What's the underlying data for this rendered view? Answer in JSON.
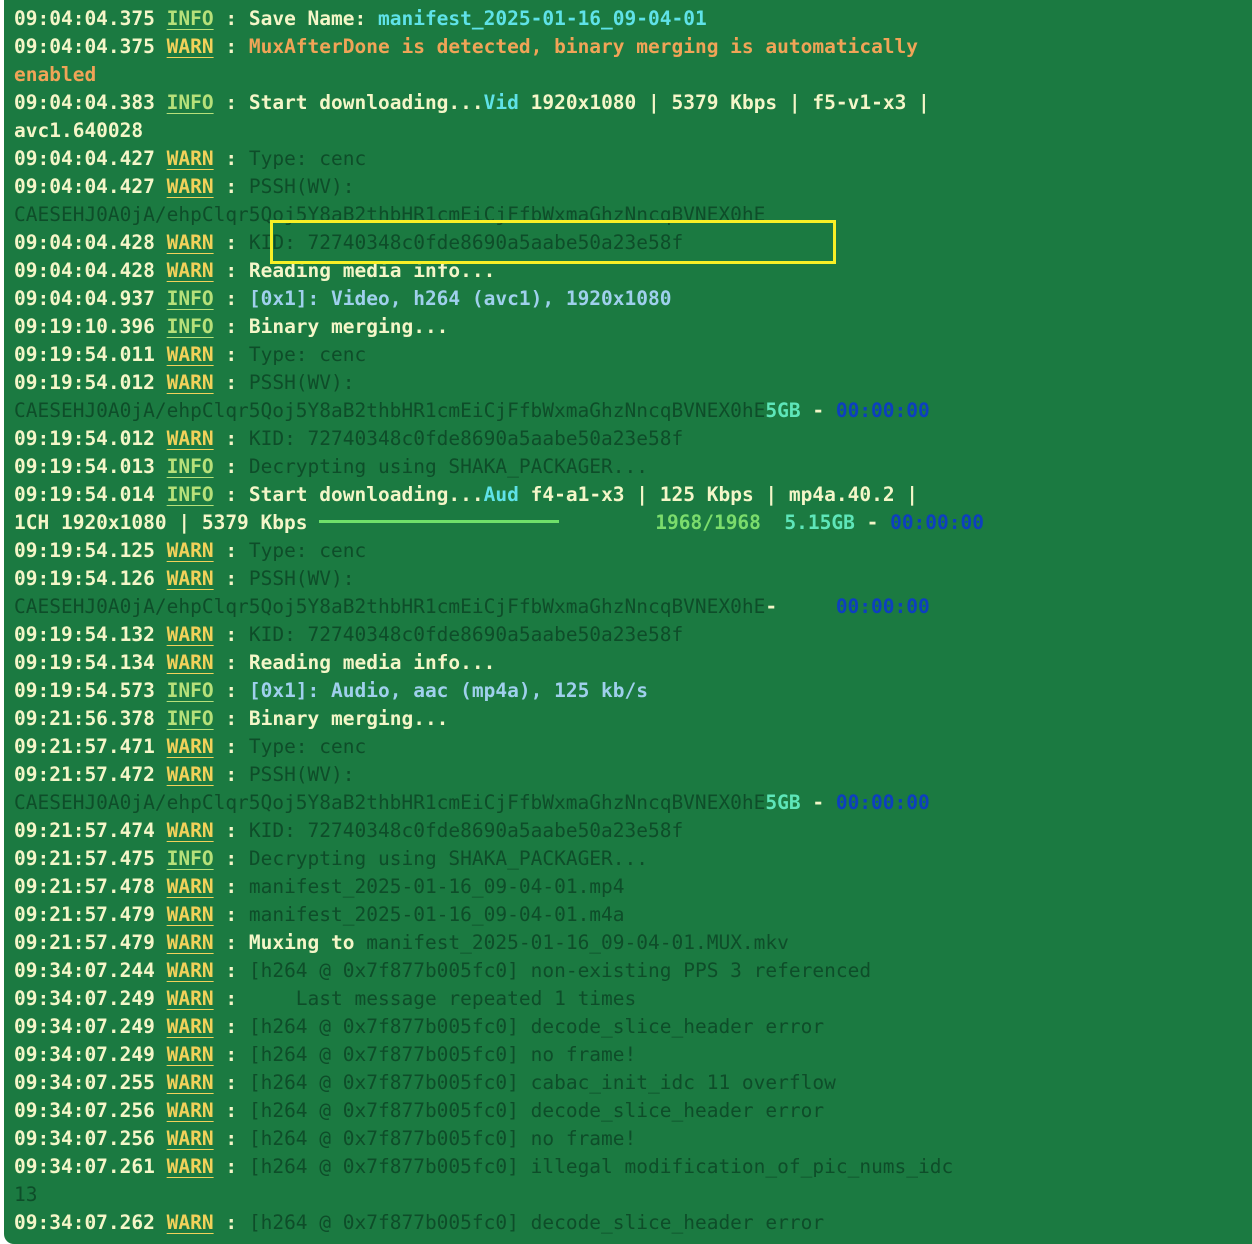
{
  "colors": {
    "background": "#1b7a41",
    "highlight": "#f7f026"
  },
  "lines": [
    {
      "ts": "09:04:04.375",
      "lvl": "INFO",
      "msg": [
        {
          "t": "Save Name: ",
          "c": "norm"
        },
        {
          "t": "manifest_2025-01-16_09-04-01",
          "c": "cyan"
        }
      ]
    },
    {
      "ts": "09:04:04.375",
      "lvl": "WARN",
      "msg": [
        {
          "t": "MuxAfterDone is detected, binary merging is automatically",
          "c": "orange"
        }
      ]
    },
    {
      "raw": [
        {
          "t": "enabled",
          "c": "orange"
        }
      ]
    },
    {
      "ts": "09:04:04.383",
      "lvl": "INFO",
      "msg": [
        {
          "t": "Start downloading...",
          "c": "norm"
        },
        {
          "t": "Vid",
          "c": "cyan"
        },
        {
          "t": " 1920x1080 | 5379 Kbps | f5-v1-x3 |",
          "c": "norm"
        }
      ]
    },
    {
      "raw": [
        {
          "t": "avc1.640028",
          "c": "norm"
        }
      ]
    },
    {
      "ts": "09:04:04.427",
      "lvl": "WARN",
      "msg": [
        {
          "t": "Type: cenc",
          "c": "dim"
        }
      ]
    },
    {
      "ts": "09:04:04.427",
      "lvl": "WARN",
      "msg": [
        {
          "t": "PSSH(WV):",
          "c": "dim"
        }
      ]
    },
    {
      "raw": [
        {
          "t": "CAESEHJ0A0jA/ehpClqr5Qoj5Y8aB2thbHR1cmEiCjFfbWxmaGhzNncqBVNEX0hE",
          "c": "dim"
        }
      ]
    },
    {
      "ts": "09:04:04.428",
      "lvl": "WARN",
      "msg": [
        {
          "t": "KID: 72740348c0fde8690a5aabe50a23e58f",
          "c": "dim"
        }
      ]
    },
    {
      "ts": "09:04:04.428",
      "lvl": "WARN",
      "msg": [
        {
          "t": "Reading media info...",
          "c": "norm"
        }
      ]
    },
    {
      "ts": "09:04:04.937",
      "lvl": "INFO",
      "msg": [
        {
          "t": "[0x1]: Video, h264 (avc1), 1920x1080",
          "c": "blue"
        }
      ]
    },
    {
      "ts": "09:19:10.396",
      "lvl": "INFO",
      "msg": [
        {
          "t": "Binary merging...",
          "c": "norm"
        }
      ]
    },
    {
      "ts": "09:19:54.011",
      "lvl": "WARN",
      "msg": [
        {
          "t": "Type: cenc",
          "c": "dim"
        }
      ]
    },
    {
      "ts": "09:19:54.012",
      "lvl": "WARN",
      "msg": [
        {
          "t": "PSSH(WV):",
          "c": "dim"
        }
      ]
    },
    {
      "raw": [
        {
          "t": "CAESEHJ0A0jA/ehpClqr5Qoj5Y8aB2thbHR1cmEiCjFfbWxmaGhzNncqBVNEX0hE",
          "c": "dim"
        },
        {
          "t": "5GB",
          "c": "aqua"
        },
        {
          "t": " - ",
          "c": "norm"
        },
        {
          "t": "00:00:00",
          "c": "navy"
        }
      ]
    },
    {
      "ts": "09:19:54.012",
      "lvl": "WARN",
      "msg": [
        {
          "t": "KID: 72740348c0fde8690a5aabe50a23e58f",
          "c": "dim"
        }
      ]
    },
    {
      "ts": "09:19:54.013",
      "lvl": "INFO",
      "msg": [
        {
          "t": "Decrypting using SHAKA_PACKAGER...",
          "c": "dim"
        }
      ]
    },
    {
      "ts": "09:19:54.014",
      "lvl": "INFO",
      "msg": [
        {
          "t": "Start downloading...",
          "c": "norm"
        },
        {
          "t": "Aud",
          "c": "cyan"
        },
        {
          "t": " f4-a1-x3 | 125 Kbps | mp4a.40.2 |",
          "c": "norm"
        }
      ]
    },
    {
      "raw": [
        {
          "t": "1CH 1920x1080 | 5379 Kbps ",
          "c": "norm"
        },
        {
          "t": "",
          "c": "bar"
        },
        {
          "t": "1968/1968",
          "c": "green"
        },
        {
          "t": "  5.15GB",
          "c": "aqua"
        },
        {
          "t": " - ",
          "c": "norm"
        },
        {
          "t": "00:00:00",
          "c": "navy"
        }
      ]
    },
    {
      "ts": "09:19:54.125",
      "lvl": "WARN",
      "msg": [
        {
          "t": "Type: cenc",
          "c": "dim"
        }
      ]
    },
    {
      "ts": "09:19:54.126",
      "lvl": "WARN",
      "msg": [
        {
          "t": "PSSH(WV):",
          "c": "dim"
        }
      ]
    },
    {
      "raw": [
        {
          "t": "CAESEHJ0A0jA/ehpClqr5Qoj5Y8aB2thbHR1cmEiCjFfbWxmaGhzNncqBVNEX0hE",
          "c": "dim"
        },
        {
          "t": "-     ",
          "c": "norm"
        },
        {
          "t": "00:00:00",
          "c": "navy"
        }
      ]
    },
    {
      "ts": "09:19:54.132",
      "lvl": "WARN",
      "msg": [
        {
          "t": "KID: 72740348c0fde8690a5aabe50a23e58f",
          "c": "dim"
        }
      ]
    },
    {
      "ts": "09:19:54.134",
      "lvl": "WARN",
      "msg": [
        {
          "t": "Reading media info...",
          "c": "norm"
        }
      ]
    },
    {
      "ts": "09:19:54.573",
      "lvl": "INFO",
      "msg": [
        {
          "t": "[0x1]: Audio, aac (mp4a), 125 kb/s",
          "c": "blue"
        }
      ]
    },
    {
      "ts": "09:21:56.378",
      "lvl": "INFO",
      "msg": [
        {
          "t": "Binary merging...",
          "c": "norm"
        }
      ]
    },
    {
      "ts": "09:21:57.471",
      "lvl": "WARN",
      "msg": [
        {
          "t": "Type: cenc",
          "c": "dim"
        }
      ]
    },
    {
      "ts": "09:21:57.472",
      "lvl": "WARN",
      "msg": [
        {
          "t": "PSSH(WV):",
          "c": "dim"
        }
      ]
    },
    {
      "raw": [
        {
          "t": "CAESEHJ0A0jA/ehpClqr5Qoj5Y8aB2thbHR1cmEiCjFfbWxmaGhzNncqBVNEX0hE",
          "c": "dim"
        },
        {
          "t": "5GB",
          "c": "aqua"
        },
        {
          "t": " - ",
          "c": "norm"
        },
        {
          "t": "00:00:00",
          "c": "navy"
        }
      ]
    },
    {
      "ts": "09:21:57.474",
      "lvl": "WARN",
      "msg": [
        {
          "t": "KID: 72740348c0fde8690a5aabe50a23e58f",
          "c": "dim"
        }
      ]
    },
    {
      "ts": "09:21:57.475",
      "lvl": "INFO",
      "msg": [
        {
          "t": "Decrypting using SHAKA_PACKAGER...",
          "c": "dim"
        }
      ]
    },
    {
      "ts": "09:21:57.478",
      "lvl": "WARN",
      "msg": [
        {
          "t": "manifest_2025-01-16_09-04-01.mp4",
          "c": "dim"
        }
      ]
    },
    {
      "ts": "09:21:57.479",
      "lvl": "WARN",
      "msg": [
        {
          "t": "manifest_2025-01-16_09-04-01.m4a",
          "c": "dim"
        }
      ]
    },
    {
      "ts": "09:21:57.479",
      "lvl": "WARN",
      "msg": [
        {
          "t": "Muxing to ",
          "c": "norm"
        },
        {
          "t": "manifest_2025-01-16_09-04-01.MUX.mkv",
          "c": "dim"
        }
      ]
    },
    {
      "ts": "09:34:07.244",
      "lvl": "WARN",
      "msg": [
        {
          "t": "[h264 @ 0x7f877b005fc0] non-existing PPS 3 referenced",
          "c": "dim"
        }
      ]
    },
    {
      "ts": "09:34:07.249",
      "lvl": "WARN",
      "msg": [
        {
          "t": "    Last message repeated 1 times",
          "c": "dim"
        }
      ]
    },
    {
      "ts": "09:34:07.249",
      "lvl": "WARN",
      "msg": [
        {
          "t": "[h264 @ 0x7f877b005fc0] decode_slice_header error",
          "c": "dim"
        }
      ]
    },
    {
      "ts": "09:34:07.249",
      "lvl": "WARN",
      "msg": [
        {
          "t": "[h264 @ 0x7f877b005fc0] no frame!",
          "c": "dim"
        }
      ]
    },
    {
      "ts": "09:34:07.255",
      "lvl": "WARN",
      "msg": [
        {
          "t": "[h264 @ 0x7f877b005fc0] cabac_init_idc 11 overflow",
          "c": "dim"
        }
      ]
    },
    {
      "ts": "09:34:07.256",
      "lvl": "WARN",
      "msg": [
        {
          "t": "[h264 @ 0x7f877b005fc0] decode_slice_header error",
          "c": "dim"
        }
      ]
    },
    {
      "ts": "09:34:07.256",
      "lvl": "WARN",
      "msg": [
        {
          "t": "[h264 @ 0x7f877b005fc0] no frame!",
          "c": "dim"
        }
      ]
    },
    {
      "ts": "09:34:07.261",
      "lvl": "WARN",
      "msg": [
        {
          "t": "[h264 @ 0x7f877b005fc0] illegal modification_of_pic_nums_idc",
          "c": "dim"
        }
      ]
    },
    {
      "raw": [
        {
          "t": "13",
          "c": "dim"
        }
      ]
    },
    {
      "ts": "09:34:07.262",
      "lvl": "WARN",
      "msg": [
        {
          "t": "[h264 @ 0x7f877b005fc0] decode_slice_header error",
          "c": "dim"
        }
      ]
    }
  ],
  "progress": {
    "value": 1.0
  }
}
